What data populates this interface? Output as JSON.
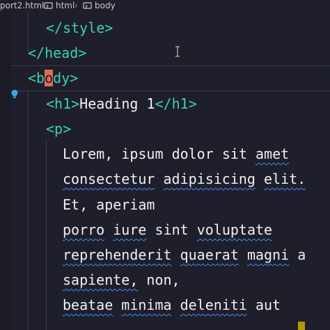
{
  "breadcrumb": {
    "file": "port2.html",
    "items": [
      "html",
      "body"
    ]
  },
  "code_lines": [
    {
      "text": "</style>"
    },
    {
      "text": "</head>"
    },
    {
      "pre": "<",
      "highlight": "o",
      "lead": "b",
      "post": "dy>"
    },
    {
      "open": "<h1>",
      "content": "Heading 1",
      "close": "</h1>"
    },
    {
      "text": "<p>"
    },
    {
      "words": [
        "Lorem,",
        "ipsum",
        "dolor",
        "sit",
        "amet"
      ]
    },
    {
      "words": [
        "consectetur",
        "adipisicing",
        "elit."
      ]
    },
    {
      "words": [
        "Et,",
        "aperiam"
      ]
    },
    {
      "words": [
        "porro",
        "iure",
        "sint",
        "voluptate"
      ]
    },
    {
      "words": [
        "reprehenderit",
        "quaerat",
        "magni",
        "a"
      ]
    },
    {
      "words": [
        "sapiente,",
        "non,"
      ]
    },
    {
      "words": [
        "beatae",
        "minima",
        "deleniti",
        "aut"
      ]
    }
  ],
  "colors": {
    "background": "#1e1f2b",
    "tag": "#39d1b8",
    "text": "#f0f0f4",
    "spell_squiggle": "#3f8ff7",
    "bracket_highlight": "#e06c55"
  },
  "icons": [
    "html-file-icon",
    "element-icon",
    "lightbulb-icon",
    "text-cursor-icon"
  ]
}
